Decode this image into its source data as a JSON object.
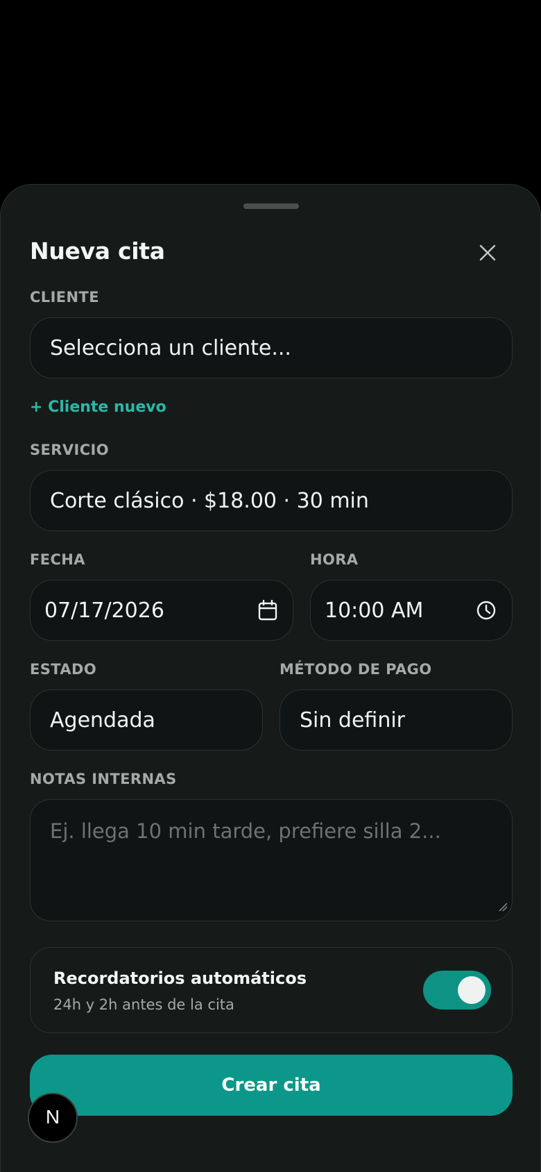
{
  "sheet": {
    "title": "Nueva cita"
  },
  "client": {
    "label": "CLIENTE",
    "value": "Selecciona un cliente...",
    "new_link": "+ Cliente nuevo"
  },
  "service": {
    "label": "SERVICIO",
    "value": "Corte clásico · $18.00 · 30 min"
  },
  "date": {
    "label": "FECHA",
    "value": "07/17/2026",
    "icon": "calendar-icon"
  },
  "time": {
    "label": "HORA",
    "value": "10:00 AM",
    "icon": "clock-icon"
  },
  "status": {
    "label": "ESTADO",
    "value": "Agendada"
  },
  "payment": {
    "label": "MÉTODO DE PAGO",
    "value": "Sin definir"
  },
  "notes": {
    "label": "NOTAS INTERNAS",
    "placeholder": "Ej. llega 10 min tarde, prefiere silla 2..."
  },
  "reminders": {
    "title": "Recordatorios automáticos",
    "subtitle": "24h y 2h antes de la cita",
    "enabled": true
  },
  "submit_label": "Crear cita",
  "badge_letter": "N",
  "colors": {
    "accent": "#0d978a",
    "link": "#2bb9a6",
    "background": "#161b1a",
    "field": "#0f1414"
  }
}
